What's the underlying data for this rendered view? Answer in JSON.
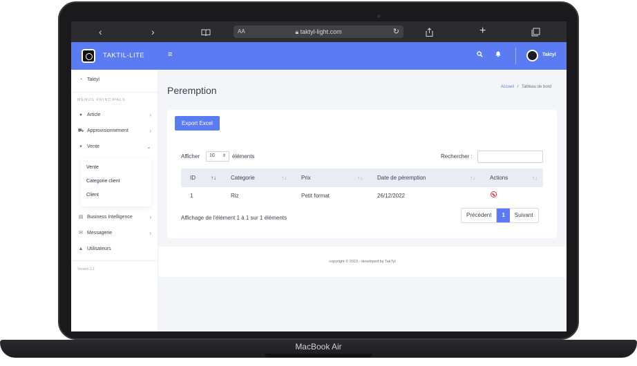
{
  "device": {
    "label": "MacBook Air"
  },
  "browser": {
    "back": "‹",
    "forward": "›",
    "reader_mode": "AA",
    "url": "taktyl-light.com"
  },
  "brand": {
    "name": "TAKTIL-LITE"
  },
  "topnav": {
    "user": "Taktyl"
  },
  "sidebar": {
    "dashboard": "Taktyl",
    "section_header": "MENUS PRINCIPALS",
    "items": [
      {
        "label": "Article"
      },
      {
        "label": "Approvisionnement"
      },
      {
        "label": "Vente"
      }
    ],
    "submenu": [
      "Vente",
      "Categorie client",
      "Client"
    ],
    "items_after": [
      {
        "label": "Business Intelligence"
      },
      {
        "label": "Messagerie"
      },
      {
        "label": "Utilisateurs"
      }
    ],
    "version": "Version 1.1"
  },
  "page": {
    "title": "Peremption",
    "breadcrumb": {
      "home": "Accueil",
      "sep": "/",
      "current": "Tableau de bord"
    }
  },
  "table_controls": {
    "export_label": "Export Excel",
    "show_prefix": "Afficher",
    "page_size": "10",
    "show_suffix": "éléments",
    "search_label": "Rechercher :",
    "search_value": ""
  },
  "table": {
    "columns": [
      "ID",
      "Categorie",
      "Prix",
      "Date de péremption",
      "Actions"
    ],
    "rows": [
      {
        "id": "1",
        "categorie": "Riz",
        "prix": "Petit format",
        "date": "26/12/2022"
      }
    ]
  },
  "pagination": {
    "info": "Affichage de l'élément 1 à 1 sur 1 éléments",
    "prev": "Précédent",
    "current": "1",
    "next": "Suivant"
  },
  "footer": {
    "text": "copyright © 2023 - developed by TakTyl"
  },
  "colors": {
    "accent": "#5a7bf2",
    "danger": "#d93b3b"
  }
}
